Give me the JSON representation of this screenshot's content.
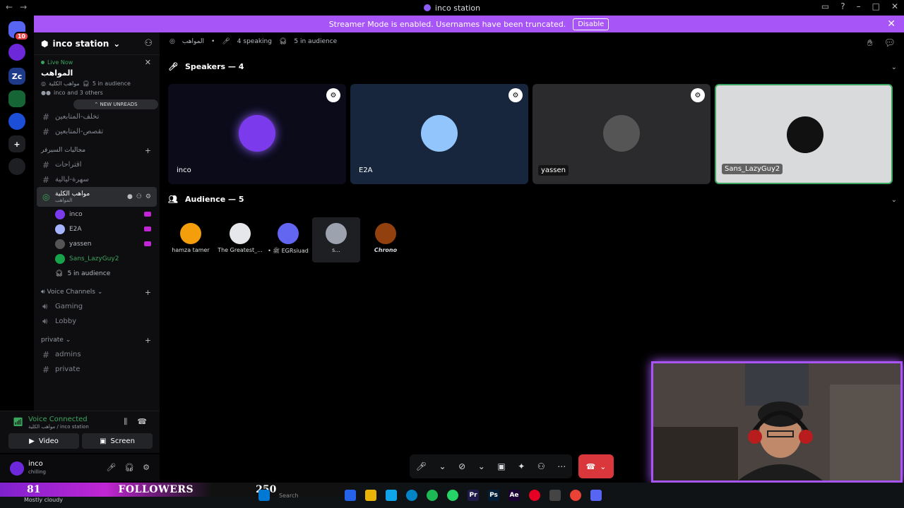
{
  "window": {
    "title": "inco station"
  },
  "guilds": [
    {
      "label": "",
      "color": "#5865f2",
      "badge": "10"
    },
    {
      "label": "",
      "color": "#6d28d9"
    },
    {
      "label": "Zc",
      "color": "#1e3a8a"
    },
    {
      "label": "",
      "color": "#166534"
    },
    {
      "label": "",
      "color": "#1d4ed8"
    },
    {
      "label": "+",
      "color": "#1e1f22"
    },
    {
      "label": "",
      "color": "#1e1f22"
    }
  ],
  "banner": {
    "text": "Streamer Mode is enabled. Usernames have been truncated.",
    "button": "Disable"
  },
  "sidebar": {
    "server_name": "inco station",
    "live": {
      "label": "Live Now",
      "title": "المواهب",
      "stage_name": "مواهب الكلية",
      "audience": "5 in audience",
      "attendees": "inco and 3 others"
    },
    "new_unreads": "NEW UNREADS",
    "channels_top": [
      {
        "name": "تخلف-المتابعين"
      },
      {
        "name": "تقصص-المتابعين"
      }
    ],
    "category_server": "مجاليات السيرفر",
    "channels_mid": [
      {
        "name": "اقتراحات"
      },
      {
        "name": "سهرة-ليالية"
      }
    ],
    "active_stage": {
      "name": "مواهب الكلية",
      "topic": "المواهب"
    },
    "members": [
      {
        "name": "inco",
        "color": "#7c3aed",
        "stream": true
      },
      {
        "name": "E2A",
        "color": "#a5b4fc",
        "stream": true
      },
      {
        "name": "yassen",
        "color": "#555",
        "stream": true
      },
      {
        "name": "Sans_LazyGuy2",
        "color": "#16a34a",
        "stream": false
      }
    ],
    "audience_count": "5 in audience",
    "category_voice": "Voice Channels",
    "voice_channels": [
      {
        "name": "Gaming"
      },
      {
        "name": "Lobby"
      }
    ],
    "category_private": "private",
    "private_channels": [
      {
        "name": "admins"
      },
      {
        "name": "private"
      }
    ]
  },
  "voice_connected": {
    "status": "Voice Connected",
    "location": "مواهب الكلية / inco station",
    "video_label": "Video",
    "screen_label": "Screen"
  },
  "user": {
    "name": "inco",
    "status": "chilling"
  },
  "stage": {
    "channel": "المواهب",
    "speaking": "4 speaking",
    "audience": "5 in audience",
    "speakers_header": "Speakers — 4",
    "audience_header": "Audience — 5",
    "speakers": [
      {
        "name": "inco",
        "bg": "#0b0b1a",
        "avatar": "#7c3aed"
      },
      {
        "name": "E2A",
        "bg": "#17263d",
        "avatar": "#93c5fd"
      },
      {
        "name": "yassen",
        "bg": "#2b2b2d",
        "avatar": "#555"
      },
      {
        "name": "Sans_LazyGuy2",
        "bg": "#d9dadc",
        "avatar": "#111"
      }
    ],
    "audience_members": [
      {
        "name": "hamza tamer",
        "color": "#f59e0b"
      },
      {
        "name": "The Greatest_...",
        "color": "#e5e7eb"
      },
      {
        "name": "• ﷺ EGRsiuad",
        "color": "#6366f1"
      },
      {
        "name": "s...",
        "color": "#9ca3af"
      },
      {
        "name": "Chrono",
        "color": "#92400e"
      }
    ]
  },
  "overlay": {
    "followers_count": "81",
    "followers_label": "FOLLOWERS",
    "followers_goal": "250",
    "weather": "Mostly cloudy",
    "search": "Search"
  }
}
